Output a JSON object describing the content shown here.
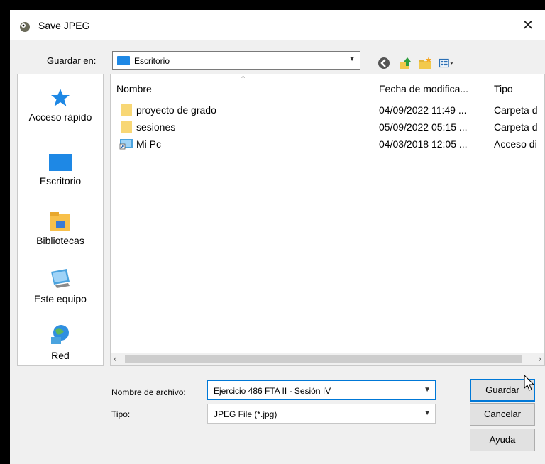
{
  "dialog": {
    "title": "Save JPEG",
    "close_glyph": "✕"
  },
  "location": {
    "label": "Guardar en:",
    "value": "Escritorio"
  },
  "toolbar": {
    "icons": [
      "back-icon",
      "up-folder-icon",
      "new-folder-icon",
      "view-menu-icon"
    ]
  },
  "places": [
    {
      "label": "Acceso rápido",
      "icon": "star-icon"
    },
    {
      "label": "Escritorio",
      "icon": "desktop-icon"
    },
    {
      "label": "Bibliotecas",
      "icon": "library-icon"
    },
    {
      "label": "Este equipo",
      "icon": "computer-icon"
    },
    {
      "label": "Red",
      "icon": "network-icon"
    }
  ],
  "file_list": {
    "columns": {
      "name": "Nombre",
      "date": "Fecha de modifica...",
      "type": "Tipo"
    },
    "rows": [
      {
        "name": "proyecto de grado",
        "date": "04/09/2022 11:49 ...",
        "type": "Carpeta d",
        "icon": "folder-icon"
      },
      {
        "name": "sesiones",
        "date": "05/09/2022 05:15 ...",
        "type": "Carpeta d",
        "icon": "folder-icon"
      },
      {
        "name": "Mi Pc",
        "date": "04/03/2018 12:05 ...",
        "type": "Acceso di",
        "icon": "shortcut-icon"
      }
    ]
  },
  "filename": {
    "label": "Nombre de archivo:",
    "value": "Ejercicio 486 FTA II - Sesión IV"
  },
  "filetype": {
    "label": "Tipo:",
    "value": "JPEG File (*.jpg)"
  },
  "buttons": {
    "save": "Guardar",
    "cancel": "Cancelar",
    "help": "Ayuda"
  },
  "colors": {
    "accent": "#0078d7",
    "folder": "#f8d775",
    "desktop": "#1e88e5"
  }
}
